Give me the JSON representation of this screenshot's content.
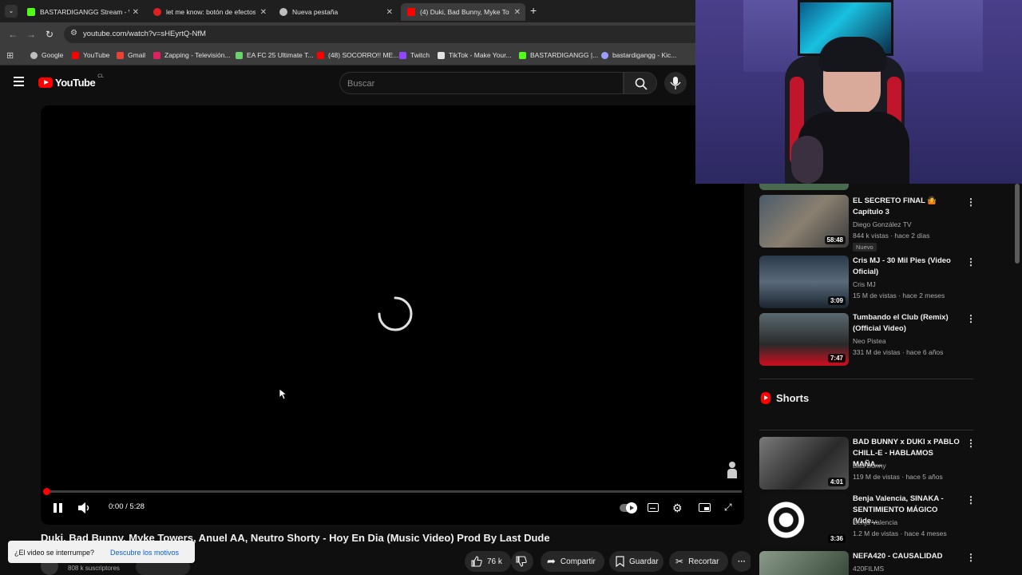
{
  "tabs": [
    {
      "title": "BASTARDIGANGG Stream - Wa",
      "fav_color": "#53fc18"
    },
    {
      "title": "let me know: botón de efectos",
      "fav_color": "#e02020"
    },
    {
      "title": "Nueva pestaña",
      "fav_color": "#bdbdbd"
    },
    {
      "title": "(4) Duki, Bad Bunny, Myke Towe",
      "fav_color": "#ff0000"
    }
  ],
  "address": {
    "url": "youtube.com/watch?v=sHEyrtQ-NfM"
  },
  "bookmarks": [
    {
      "label": "Google",
      "color": "#bdbdbd"
    },
    {
      "label": "YouTube",
      "color": "#ff0000"
    },
    {
      "label": "Gmail",
      "color": "#ea4335"
    },
    {
      "label": "Zapping - Televisión...",
      "color": "#e02060"
    },
    {
      "label": "EA FC 25 Ultimate T...",
      "color": "#6bd36b"
    },
    {
      "label": "(48) SOCORRO!! ME...",
      "color": "#ff0000"
    },
    {
      "label": "Twitch",
      "color": "#9146ff"
    },
    {
      "label": "TikTok - Make Your...",
      "color": "#e3e3e3"
    },
    {
      "label": "BASTARDIGANGG |...",
      "color": "#53fc18"
    },
    {
      "label": "bastardigangg - Kic...",
      "color": "#9aa0ff"
    }
  ],
  "youtube": {
    "logo_text": "YouTube",
    "country": "CL",
    "search_placeholder": "Buscar"
  },
  "player": {
    "time": "0:00 / 5:28",
    "progress_fraction": 0.0
  },
  "video": {
    "title": "Duki, Bad Bunny, Myke Towers, Anuel AA, Neutro Shorty - Hoy En Dia (Music Video) Prod By Last Dude",
    "subscribers": "808 k suscriptores",
    "like_count": "76 k",
    "share_label": "Compartir",
    "save_label": "Guardar",
    "clip_label": "Recortar"
  },
  "toast": {
    "question": "¿El video se interrumpe?",
    "link": "Descubre los motivos"
  },
  "recommendations": [
    {
      "title": "EL SECRETO FINAL 🤷 Capítulo 3",
      "channel": "Diego González TV",
      "meta": "844 k vistas · hace 2 días",
      "duration": "58:48",
      "badge": "Nuevo"
    },
    {
      "title": "Cris MJ - 30 Mil Pies (Video Oficial)",
      "channel": "Cris MJ",
      "meta": "15 M de vistas · hace 2 meses",
      "duration": "3:09"
    },
    {
      "title": "Tumbando el Club (Remix) (Official Video)",
      "channel": "Neo Pistea",
      "meta": "331 M de vistas · hace 6 años",
      "duration": "7:47"
    }
  ],
  "shorts_heading": "Shorts",
  "more_videos": [
    {
      "title": "BAD BUNNY x DUKI x PABLO CHILL-E - HABLAMOS MAÑA...",
      "channel": "Bad Bunny",
      "meta": "119 M de vistas · hace 5 años",
      "duration": "4:01"
    },
    {
      "title": "Benja Valencia, SINAKA - SENTIMIENTO MÁGICO (Vide...",
      "channel": "Benja Valencia",
      "meta": "1.2 M de vistas · hace 4 meses",
      "duration": "3:36"
    },
    {
      "title": "NEFA420 - CAUSALIDAD",
      "channel": "420FILMS",
      "meta": "",
      "duration": ""
    }
  ]
}
